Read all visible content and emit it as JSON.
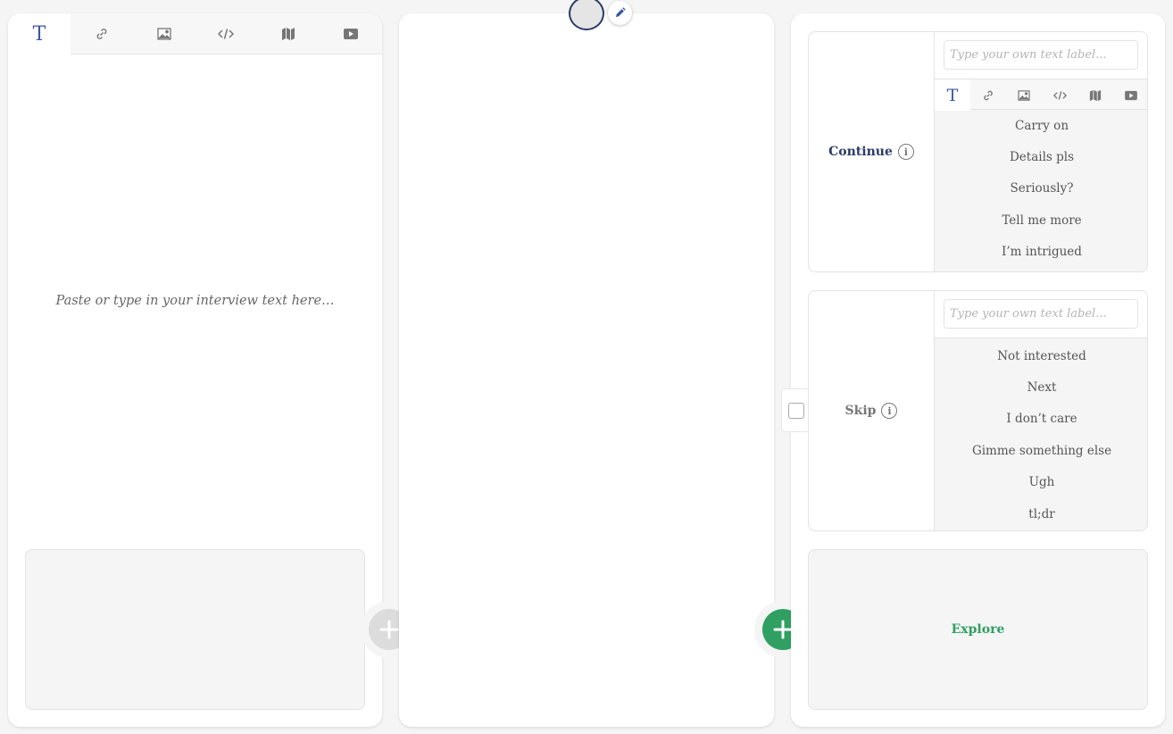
{
  "editor": {
    "tabs": [
      {
        "icon": "text-icon",
        "glyph": "T",
        "active": true
      },
      {
        "icon": "link-icon",
        "active": false
      },
      {
        "icon": "image-icon",
        "active": false
      },
      {
        "icon": "code-icon",
        "active": false
      },
      {
        "icon": "map-icon",
        "active": false
      },
      {
        "icon": "video-icon",
        "active": false
      }
    ],
    "placeholder": "Paste or type in your interview text here…"
  },
  "responses": {
    "continue": {
      "label": "Continue",
      "input_placeholder": "Type your own text label...",
      "tab_glyph": "T",
      "options": [
        "Carry on",
        "Details pls",
        "Seriously?",
        "Tell me more",
        "I’m intrigued"
      ]
    },
    "skip": {
      "label": "Skip",
      "input_placeholder": "Type your own text label...",
      "options": [
        "Not interested",
        "Next",
        "I don’t care",
        "Gimme something else",
        "Ugh",
        "tl;dr"
      ]
    },
    "explore": {
      "label": "Explore"
    }
  },
  "colors": {
    "accent_blue": "#3a57a7",
    "navy": "#2b3b66",
    "green": "#2fa062",
    "disabled_grey": "#dcdcdc"
  }
}
